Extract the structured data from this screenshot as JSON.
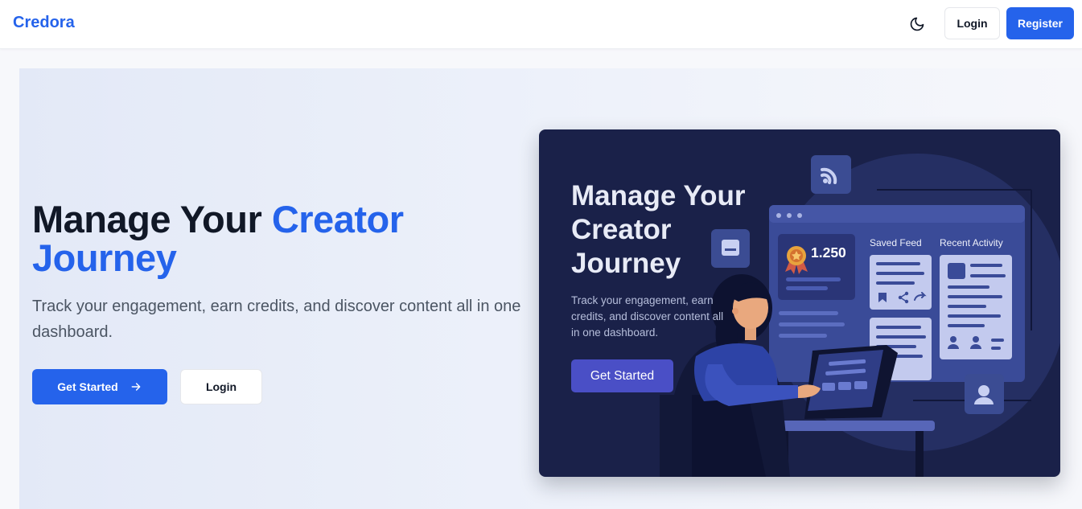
{
  "nav": {
    "brand": "Credora",
    "theme_icon": "moon-icon",
    "login": "Login",
    "register": "Register"
  },
  "hero": {
    "title_part1": "Manage Your ",
    "title_accent": "Creator Journey",
    "subtitle": "Track your engagement, earn credits, and discover content all in one dashboard.",
    "cta_primary": "Get Started",
    "cta_primary_icon": "arrow-right-icon",
    "cta_secondary": "Login"
  },
  "illustration": {
    "title": "Manage Your Creator Journey",
    "subtitle": "Track your engagement, earn credits, and discover content all in one dashboard.",
    "button": "Get Started",
    "credits": "1.250",
    "saved_feed": "Saved Feed",
    "recent_activity": "Recent Activity",
    "icons": [
      "rss-icon",
      "chat-icon",
      "badge-icon",
      "user-icon",
      "bookmark-icon",
      "share-icon",
      "forward-icon"
    ]
  },
  "colors": {
    "brand": "#2563eb",
    "illustration_bg": "#1a2149",
    "illustration_button": "#4a4fc6"
  }
}
